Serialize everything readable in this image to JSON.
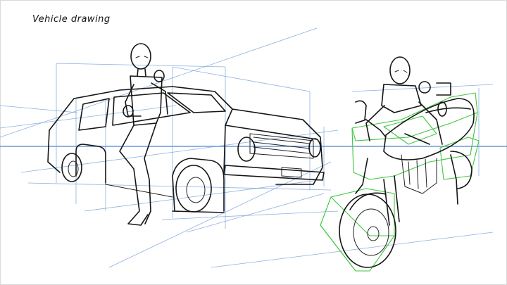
{
  "canvas": {
    "title": "Vehicle drawing",
    "background": "#ffffff",
    "colors": {
      "ink": "#151515",
      "perspective_guides": "#6f9ed8",
      "horizon_line": "#4f86d0",
      "construction_boxes": "#3fc63f"
    }
  }
}
